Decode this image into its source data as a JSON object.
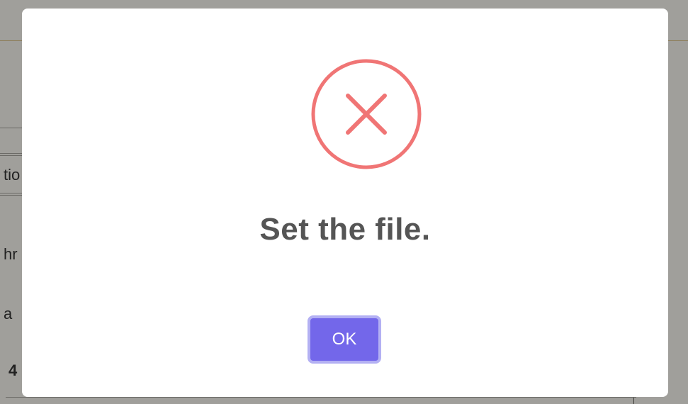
{
  "background": {
    "fragments": [
      "tio",
      "hr",
      "a",
      "4"
    ]
  },
  "dialog": {
    "icon": "error-x-circle-icon",
    "message": "Set the file.",
    "ok_label": "OK"
  },
  "colors": {
    "icon": "#f07575",
    "message": "#555555",
    "button": "#7367ea",
    "button_focus_ring": "#b3b0f3"
  }
}
